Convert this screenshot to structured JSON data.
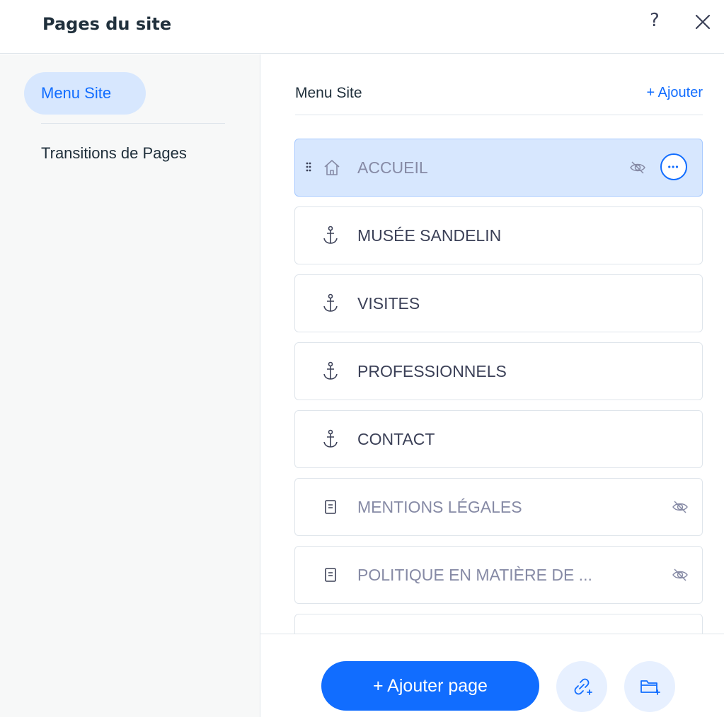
{
  "header": {
    "title": "Pages du site",
    "help": "?"
  },
  "sidebar": {
    "items": [
      {
        "label": "Menu Site",
        "active": true
      },
      {
        "label": "Transitions de Pages",
        "active": false
      }
    ]
  },
  "main": {
    "heading": "Menu Site",
    "add_label": "+ Ajouter",
    "pages": [
      {
        "label": "ACCUEIL",
        "icon": "home-icon",
        "hidden": true,
        "selected": true
      },
      {
        "label": "MUSÉE SANDELIN",
        "icon": "anchor-icon",
        "hidden": false
      },
      {
        "label": "VISITES",
        "icon": "anchor-icon",
        "hidden": false
      },
      {
        "label": "PROFESSIONNELS",
        "icon": "anchor-icon",
        "hidden": false
      },
      {
        "label": "CONTACT",
        "icon": "anchor-icon",
        "hidden": false
      },
      {
        "label": "MENTIONS LÉGALES",
        "icon": "page-icon",
        "hidden": true
      },
      {
        "label": "POLITIQUE EN MATIÈRE DE ...",
        "icon": "page-icon",
        "hidden": true
      }
    ]
  },
  "footer": {
    "add_page_label": "+ Ajouter page"
  },
  "colors": {
    "accent": "#116dff",
    "selected_bg": "#d7e7fe",
    "text": "#20303c"
  }
}
